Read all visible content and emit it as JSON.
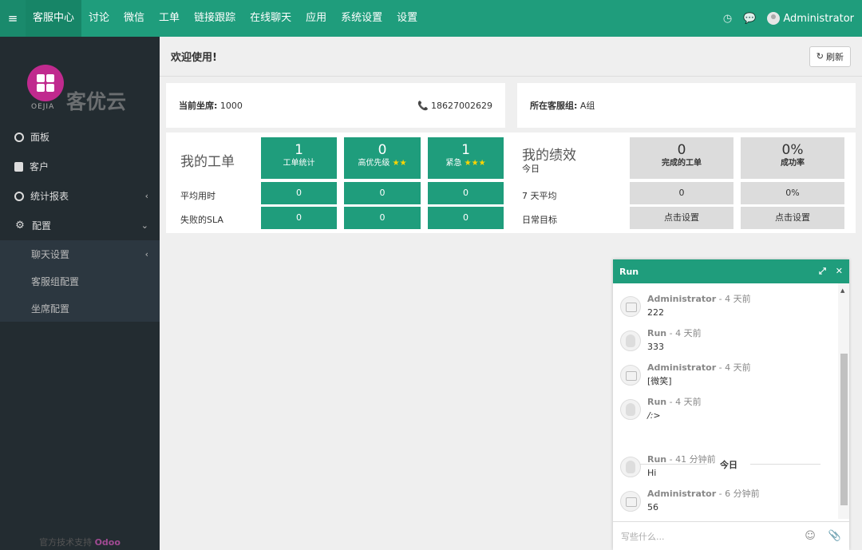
{
  "topbar": {
    "nav": [
      "客服中心",
      "讨论",
      "微信",
      "工单",
      "链接跟踪",
      "在线聊天",
      "应用",
      "系统设置",
      "设置"
    ],
    "user": "Administrator"
  },
  "sidebar": {
    "brand_cn": "客优云",
    "brand_en": "OEJIA",
    "items": [
      {
        "label": "面板",
        "icon": "circle-icon"
      },
      {
        "label": "客户",
        "icon": "user-card-icon"
      },
      {
        "label": "统计报表",
        "icon": "circle-icon"
      },
      {
        "label": "配置",
        "icon": "gear-icon"
      }
    ],
    "submenu": [
      "聊天设置",
      "客服组配置",
      "坐席配置"
    ],
    "footer_prefix": "官方技术支持",
    "footer_brand": "Odoo"
  },
  "main": {
    "title": "欢迎使用!",
    "refresh": "刷新",
    "seat_label": "当前坐席:",
    "seat_value": "1000",
    "phone": "18627002629",
    "group_label": "所在客服组:",
    "group_value": "A组"
  },
  "my_tickets": {
    "title": "我的工单",
    "row_labels": [
      "平均用时",
      "失败的SLA"
    ],
    "tiles": [
      {
        "value": "1",
        "label": "工单统计",
        "stars": ""
      },
      {
        "value": "0",
        "label": "高优先级",
        "stars": "★★"
      },
      {
        "value": "1",
        "label": "紧急",
        "stars": "★★★"
      }
    ],
    "avg_time": [
      "0",
      "0",
      "0"
    ],
    "failed_sla": [
      "0",
      "0",
      "0"
    ]
  },
  "my_performance": {
    "title": "我的绩效",
    "today": "今日",
    "row_labels": [
      "7 天平均",
      "日常目标"
    ],
    "tiles": [
      {
        "value": "0",
        "label": "完成的工单"
      },
      {
        "value": "0%",
        "label": "成功率"
      }
    ],
    "avg7": [
      "0",
      "0%"
    ],
    "target": [
      "点击设置",
      "点击设置"
    ]
  },
  "chat": {
    "title": "Run",
    "messages": [
      {
        "author": "Administrator",
        "time": " - 4 天前",
        "text": "222",
        "avatar": "admin"
      },
      {
        "author": "Run",
        "time": " - 4 天前",
        "text": "333",
        "avatar": "guest"
      },
      {
        "author": "Administrator",
        "time": " - 4 天前",
        "text": "[微笑]",
        "avatar": "admin"
      },
      {
        "author": "Run",
        "time": " - 4 天前",
        "text": "/:>",
        "avatar": "guest"
      },
      {
        "author": "Run",
        "time": " - 41 分钟前",
        "text": "Hi",
        "avatar": "guest"
      },
      {
        "author": "Administrator",
        "time": " - 6 分钟前",
        "text": "56",
        "avatar": "admin"
      }
    ],
    "day_separator": "今日",
    "input_placeholder": "写些什么..."
  }
}
